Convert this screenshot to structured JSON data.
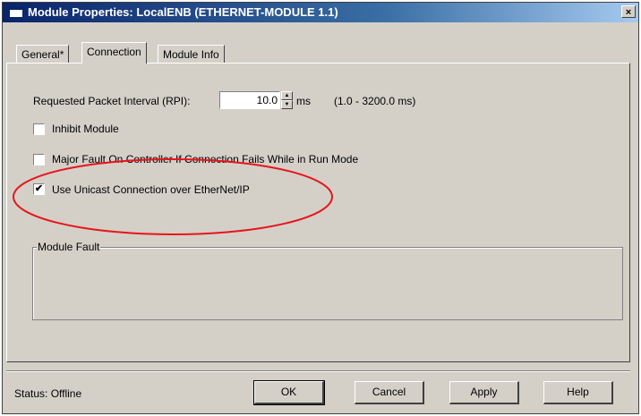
{
  "window": {
    "title": "Module Properties: LocalENB (ETHERNET-MODULE 1.1)",
    "close_glyph": "×"
  },
  "tabs": [
    {
      "label": "General*"
    },
    {
      "label": "Connection"
    },
    {
      "label": "Module Info"
    }
  ],
  "connection": {
    "rpi_label": "Requested Packet Interval (RPI):",
    "rpi_value": "10.0",
    "rpi_unit": "ms",
    "rpi_range": "(1.0 - 3200.0 ms)",
    "inhibit_label": "Inhibit Module",
    "inhibit_checked": "",
    "major_fault_label": "Major Fault On Controller If Connection Fails While in Run Mode",
    "major_fault_checked": "",
    "unicast_label": "Use Unicast Connection over EtherNet/IP",
    "unicast_checked": "✔"
  },
  "module_fault": {
    "label": "Module Fault"
  },
  "status": {
    "text": "Status:  Offline"
  },
  "buttons": {
    "ok": "OK",
    "cancel": "Cancel",
    "apply": "Apply",
    "help": "Help"
  },
  "colors": {
    "annotation_ellipse": "#e8141b",
    "title_bar": "#0a246a",
    "dialog_bg": "#d4d0c8"
  },
  "icons": {
    "close": "close-icon",
    "spinner_up": "spinner-up-icon",
    "spinner_down": "spinner-down-icon"
  }
}
